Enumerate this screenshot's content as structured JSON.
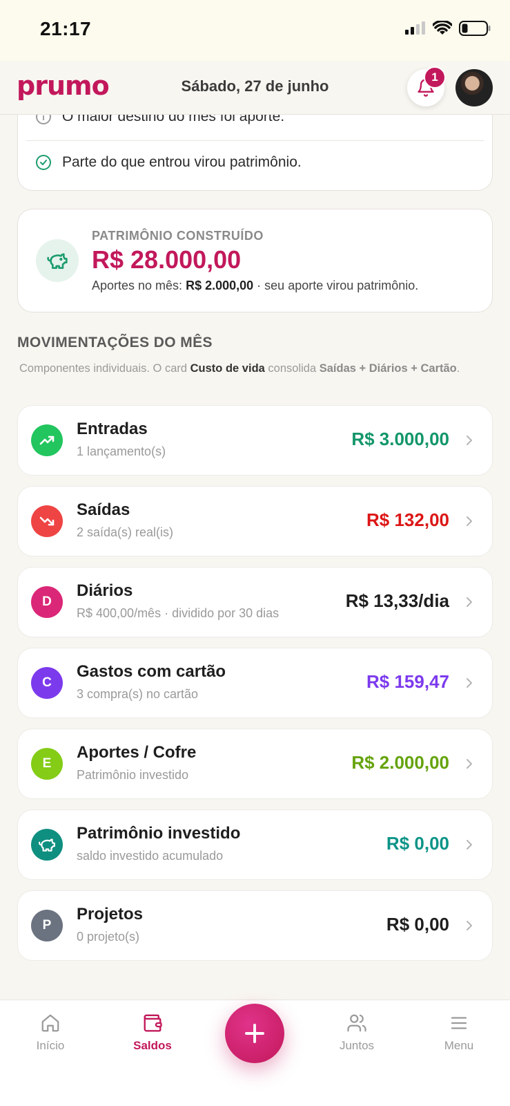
{
  "status_bar": {
    "time": "21:17"
  },
  "header": {
    "logo": "prumo",
    "date": "Sábado, 27 de junho",
    "notification_count": "1"
  },
  "insights": [
    {
      "icon": "info-icon",
      "text": "O maior destino do mês foi aporte."
    },
    {
      "icon": "check-circle-icon",
      "text": "Parte do que entrou virou patrimônio."
    }
  ],
  "patrimonio": {
    "label": "PATRIMÔNIO CONSTRUÍDO",
    "value": "R$ 28.000,00",
    "sub_prefix": "Aportes no mês:",
    "sub_amount": "R$ 2.000,00",
    "sub_suffix": "· seu aporte virou patrimônio."
  },
  "section": {
    "title": "MOVIMENTAÇÕES DO MÊS",
    "desc_1": "Componentes individuais. O card",
    "desc_bold_1": "Custo de vida",
    "desc_2": "consolida",
    "desc_bold_2": "Saídas + Diários + Cartão",
    "desc_end": "."
  },
  "movements": [
    {
      "title": "Entradas",
      "sub": "1 lançamento(s)",
      "value": "R$ 3.000,00",
      "icon": "trend-up-icon",
      "icon_text": "",
      "color": "#12966a",
      "icon_bg": "#22c55e"
    },
    {
      "title": "Saídas",
      "sub": "2 saída(s) real(is)",
      "value": "R$ 132,00",
      "icon": "trend-down-icon",
      "icon_text": "",
      "color": "#dc1616",
      "icon_bg": "#ef4444"
    },
    {
      "title": "Diários",
      "sub": "R$ 400,00/mês · dividido por 30 dias",
      "value": "R$ 13,33/dia",
      "icon": "letter-d-icon",
      "icon_text": "D",
      "color": "#1e1e1e",
      "icon_bg": "#db2777"
    },
    {
      "title": "Gastos com cartão",
      "sub": "3 compra(s) no cartão",
      "value": "R$ 159,47",
      "icon": "letter-c-icon",
      "icon_text": "C",
      "color": "#7c3aed",
      "icon_bg": "#7c3aed"
    },
    {
      "title": "Aportes / Cofre",
      "sub": "Patrimônio investido",
      "value": "R$ 2.000,00",
      "icon": "letter-e-icon",
      "icon_text": "E",
      "color": "#65a30d",
      "icon_bg": "#84cc16"
    },
    {
      "title": "Patrimônio investido",
      "sub": "saldo investido acumulado",
      "value": "R$ 0,00",
      "icon": "piggy-bank-icon",
      "icon_text": "",
      "color": "#0d9488",
      "icon_bg": "#0f8f80"
    },
    {
      "title": "Projetos",
      "sub": "0 projeto(s)",
      "value": "R$ 0,00",
      "icon": "letter-p-icon",
      "icon_text": "P",
      "color": "#1e1e1e",
      "icon_bg": "#6b7280"
    }
  ],
  "nav": {
    "home": "Início",
    "saldos": "Saldos",
    "juntos": "Juntos",
    "menu": "Menu"
  }
}
